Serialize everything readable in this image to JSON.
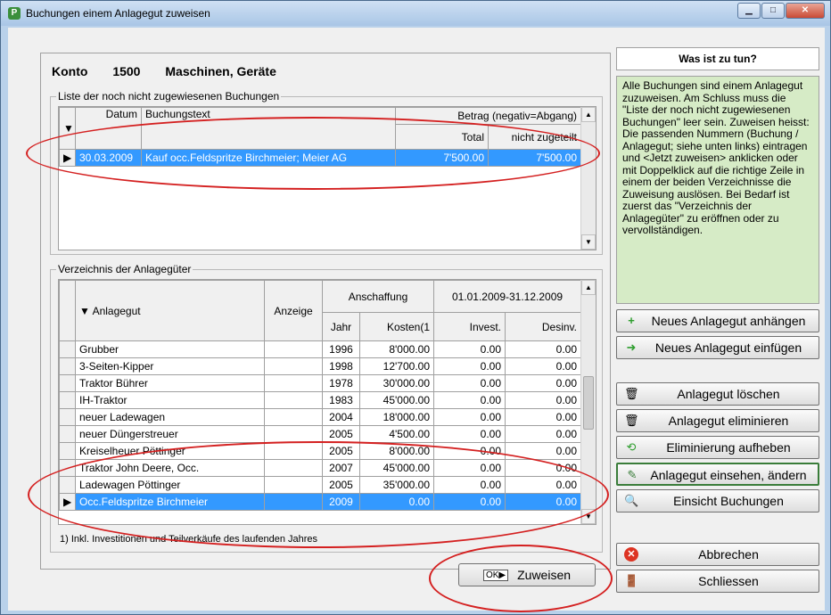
{
  "window": {
    "title": "Buchungen einem Anlagegut zuweisen",
    "icon": "app-icon"
  },
  "titlebar_buttons": {
    "minimize": "▁",
    "maximize": "□",
    "close": "✕"
  },
  "konto": {
    "label": "Konto",
    "number": "1500",
    "name": "Maschinen, Geräte"
  },
  "bookings": {
    "group_label": "Liste der noch nicht zugewiesenen Buchungen",
    "headers": {
      "datum": "Datum",
      "buchungstext": "Buchungstext",
      "betrag": "Betrag (negativ=Abgang)",
      "total": "Total",
      "nicht_zugeteilt": "nicht zugeteilt"
    },
    "rows": [
      {
        "datum": "30.03.2009",
        "text": "Kauf occ.Feldspritze Birchmeier; Meier AG",
        "total": "7'500.00",
        "nicht_zugeteilt": "7'500.00",
        "selected": true
      }
    ]
  },
  "assets": {
    "group_label": "Verzeichnis der Anlagegüter",
    "headers": {
      "anlagegut": "Anlagegut",
      "anzeige": "Anzeige",
      "anschaffung": "Anschaffung",
      "period": "01.01.2009-31.12.2009",
      "jahr": "Jahr",
      "kosten": "Kosten(1",
      "invest": "Invest.",
      "desinv": "Desinv."
    },
    "rows": [
      {
        "name": "Grubber",
        "anzeige": "",
        "jahr": "1996",
        "kosten": "8'000.00",
        "invest": "0.00",
        "desinv": "0.00",
        "selected": false
      },
      {
        "name": "3-Seiten-Kipper",
        "anzeige": "",
        "jahr": "1998",
        "kosten": "12'700.00",
        "invest": "0.00",
        "desinv": "0.00",
        "selected": false
      },
      {
        "name": "Traktor Bührer",
        "anzeige": "",
        "jahr": "1978",
        "kosten": "30'000.00",
        "invest": "0.00",
        "desinv": "0.00",
        "selected": false
      },
      {
        "name": "IH-Traktor",
        "anzeige": "",
        "jahr": "1983",
        "kosten": "45'000.00",
        "invest": "0.00",
        "desinv": "0.00",
        "selected": false
      },
      {
        "name": "neuer Ladewagen",
        "anzeige": "",
        "jahr": "2004",
        "kosten": "18'000.00",
        "invest": "0.00",
        "desinv": "0.00",
        "selected": false
      },
      {
        "name": "neuer Düngerstreuer",
        "anzeige": "",
        "jahr": "2005",
        "kosten": "4'500.00",
        "invest": "0.00",
        "desinv": "0.00",
        "selected": false
      },
      {
        "name": "Kreiselheuer Pöttinger",
        "anzeige": "",
        "jahr": "2005",
        "kosten": "8'000.00",
        "invest": "0.00",
        "desinv": "0.00",
        "selected": false
      },
      {
        "name": "Traktor John Deere, Occ.",
        "anzeige": "",
        "jahr": "2007",
        "kosten": "45'000.00",
        "invest": "0.00",
        "desinv": "0.00",
        "selected": false
      },
      {
        "name": "Ladewagen Pöttinger",
        "anzeige": "",
        "jahr": "2005",
        "kosten": "35'000.00",
        "invest": "0.00",
        "desinv": "0.00",
        "selected": false
      },
      {
        "name": "Occ.Feldspritze Birchmeier",
        "anzeige": "",
        "jahr": "2009",
        "kosten": "0.00",
        "invest": "0.00",
        "desinv": "0.00",
        "selected": true
      }
    ],
    "footnote": "1) Inkl. Investitionen und Teilverkäufe des laufenden Jahres"
  },
  "assign_button": {
    "label": "Zuweisen",
    "icon": "ok-arrow-icon"
  },
  "help": {
    "title": "Was ist zu tun?",
    "text": "Alle Buchungen sind einem Anlagegut zuzuweisen. Am Schluss muss die \"Liste der noch nicht zugewiesenen Buchungen\" leer sein. Zuweisen heisst: Die passenden Nummern (Buchung / Anlagegut; siehe unten links) eintragen und <Jetzt zuweisen> anklicken oder mit Doppelklick auf die richtige Zeile in einem der beiden Verzeichnisse die Zuweisung auslösen. Bei Bedarf ist zuerst das \"Verzeichnis der Anlagegüter\" zu eröffnen oder zu vervollständigen."
  },
  "side_buttons": {
    "new_append": "Neues Anlagegut anhängen",
    "new_insert": "Neues Anlagegut einfügen",
    "delete": "Anlagegut löschen",
    "eliminate": "Anlagegut eliminieren",
    "undo_eliminate": "Eliminierung aufheben",
    "view_edit": "Anlagegut einsehen, ändern",
    "view_bookings": "Einsicht Buchungen",
    "cancel": "Abbrechen",
    "close": "Schliessen"
  },
  "colors": {
    "selection": "#3399ff",
    "help_bg": "#d6ebc6",
    "annotation": "#d42020"
  }
}
